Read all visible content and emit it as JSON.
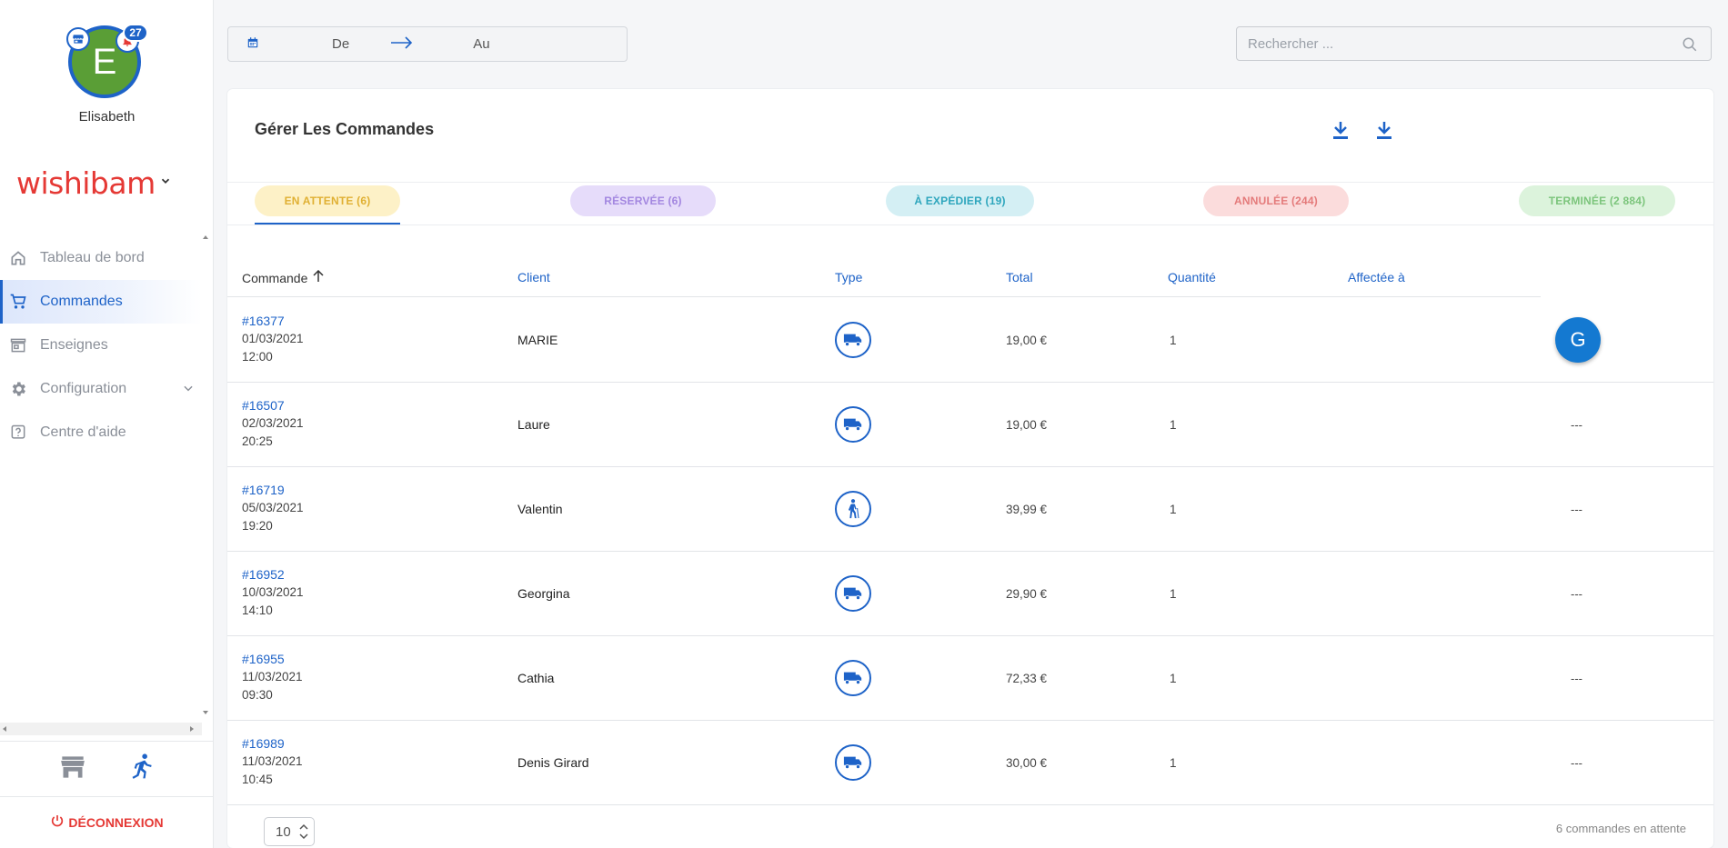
{
  "user": {
    "initial": "E",
    "name": "Elisabeth",
    "notifications": "27",
    "avatar_color": "#5a9e36"
  },
  "brand": {
    "name": "wishibam",
    "color": "#e53935"
  },
  "nav": {
    "items": [
      {
        "label": "Tableau de bord",
        "icon": "home-icon"
      },
      {
        "label": "Commandes",
        "icon": "cart-icon",
        "active": true
      },
      {
        "label": "Enseignes",
        "icon": "store-icon"
      },
      {
        "label": "Configuration",
        "icon": "gear-icon"
      },
      {
        "label": "Centre d'aide",
        "icon": "help-icon"
      }
    ]
  },
  "logout_label": "DÉCONNEXION",
  "daterange": {
    "from": "De",
    "to": "Au"
  },
  "search": {
    "placeholder": "Rechercher ..."
  },
  "card": {
    "title": "Gérer Les Commandes"
  },
  "tabs": [
    {
      "label": "EN ATTENTE (6)",
      "bg": "#fdf1c7",
      "color": "#e0b033",
      "active": true
    },
    {
      "label": "RÉSERVÉE (6)",
      "bg": "#e6dcfa",
      "color": "#a387e0"
    },
    {
      "label": "À EXPÉDIER (19)",
      "bg": "#d4eff4",
      "color": "#2ea6bd"
    },
    {
      "label": "ANNULÉE (244)",
      "bg": "#fbdcdc",
      "color": "#e47b7b"
    },
    {
      "label": "TERMINÉE (2 884)",
      "bg": "#dcf3dc",
      "color": "#7cc57c"
    }
  ],
  "table": {
    "headers": {
      "order": "Commande",
      "client": "Client",
      "type": "Type",
      "total": "Total",
      "quantity": "Quantité",
      "assigned": "Affectée à"
    },
    "rows": [
      {
        "order": "#16377",
        "date": "01/03/2021",
        "time": "12:00",
        "client": "MARIE",
        "type": "truck-icon",
        "total": "19,00 €",
        "qty": "1",
        "assigned": "G"
      },
      {
        "order": "#16507",
        "date": "02/03/2021",
        "time": "20:25",
        "client": "Laure",
        "type": "truck-icon",
        "total": "19,00 €",
        "qty": "1",
        "assigned": "---"
      },
      {
        "order": "#16719",
        "date": "05/03/2021",
        "time": "19:20",
        "client": "Valentin",
        "type": "walker-icon",
        "total": "39,99 €",
        "qty": "1",
        "assigned": "---"
      },
      {
        "order": "#16952",
        "date": "10/03/2021",
        "time": "14:10",
        "client": "Georgina",
        "type": "truck-icon",
        "total": "29,90 €",
        "qty": "1",
        "assigned": "---"
      },
      {
        "order": "#16955",
        "date": "11/03/2021",
        "time": "09:30",
        "client": "Cathia",
        "type": "truck-icon",
        "total": "72,33 €",
        "qty": "1",
        "assigned": "---"
      },
      {
        "order": "#16989",
        "date": "11/03/2021",
        "time": "10:45",
        "client": "Denis Girard",
        "type": "truck-icon",
        "total": "30,00 €",
        "qty": "1",
        "assigned": "---"
      }
    ]
  },
  "pagination": {
    "page_size": "10",
    "summary": "6 commandes en attente"
  },
  "colors": {
    "accent": "#1e63c8",
    "danger": "#e53935"
  }
}
